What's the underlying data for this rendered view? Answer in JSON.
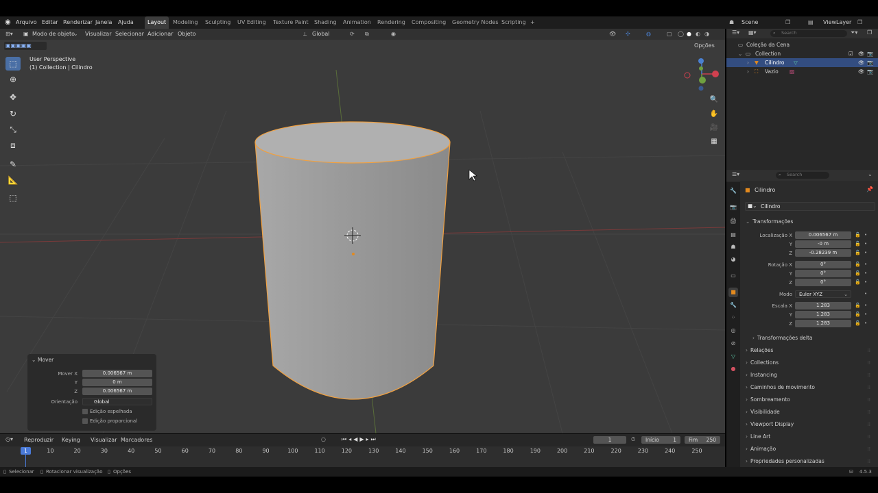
{
  "topbar": {
    "menus": [
      "Arquivo",
      "Editar",
      "Renderizar",
      "Janela",
      "Ajuda"
    ],
    "workspaces": [
      "Layout",
      "Modeling",
      "Sculpting",
      "UV Editing",
      "Texture Paint",
      "Shading",
      "Animation",
      "Rendering",
      "Compositing",
      "Geometry Nodes",
      "Scripting"
    ],
    "add_tab": "+",
    "scene": "Scene",
    "view_layer": "ViewLayer"
  },
  "viewport_header": {
    "mode": "Modo de objeto",
    "menus": [
      "Visualizar",
      "Selecionar",
      "Adicionar",
      "Objeto"
    ],
    "orientation": "Global",
    "options": "Opções"
  },
  "viewport": {
    "perspective": "User Perspective",
    "collection_info": "(1) Collection | Cilindro",
    "object_color": "#9e9e9e",
    "outline_color": "#f0a040"
  },
  "operator_panel": {
    "title": "Mover",
    "move_x_label": "Mover X",
    "y_label": "Y",
    "z_label": "Z",
    "move_x": "0.006567 m",
    "move_y": "0 m",
    "move_z": "0.006567 m",
    "orientation_label": "Orientação",
    "orientation_value": "Global",
    "mirror": "Edição espelhada",
    "proportional": "Edição proporcional"
  },
  "timeline": {
    "menus": [
      "Reproduzir",
      "Keying",
      "Visualizar",
      "Marcadores"
    ],
    "current_frame": "1",
    "start_label": "Início",
    "start": "1",
    "end_label": "Fim",
    "end": "250",
    "ticks": [
      "1",
      "10",
      "20",
      "30",
      "40",
      "50",
      "60",
      "70",
      "80",
      "90",
      "100",
      "110",
      "120",
      "130",
      "140",
      "150",
      "160",
      "170",
      "180",
      "190",
      "200",
      "210",
      "220",
      "230",
      "240",
      "250"
    ],
    "playhead": "1"
  },
  "statusbar": {
    "select": "Selecionar",
    "rotate": "Rotacionar visualização",
    "options": "Opções",
    "version": "4.5.3"
  },
  "outliner": {
    "search_placeholder": "Search",
    "scene_collection": "Coleção da Cena",
    "items": [
      {
        "name": "Collection"
      },
      {
        "name": "Cilindro"
      },
      {
        "name": "Vazio"
      }
    ]
  },
  "properties": {
    "search_placeholder": "Search",
    "object_name": "Cilindro",
    "object_field": "Cilindro",
    "transform_title": "Transformações",
    "location_label": "Localização X",
    "loc_x": "0.006567 m",
    "loc_y": "-0 m",
    "loc_z": "-0.28239 m",
    "rotation_label": "Rotação X",
    "rot_x": "0°",
    "rot_y": "0°",
    "rot_z": "0°",
    "mode_label": "Modo",
    "mode_value": "Euler XYZ",
    "scale_label": "Escala X",
    "scale_x": "1.283",
    "scale_y": "1.283",
    "scale_z": "1.283",
    "y_label": "Y",
    "z_label": "Z",
    "delta_title": "Transformações delta",
    "sections": [
      "Relações",
      "Collections",
      "Instancing",
      "Caminhos de movimento",
      "Sombreamento",
      "Visibilidade",
      "Viewport Display",
      "Line Art",
      "Animação",
      "Propriedades personalizadas"
    ]
  }
}
